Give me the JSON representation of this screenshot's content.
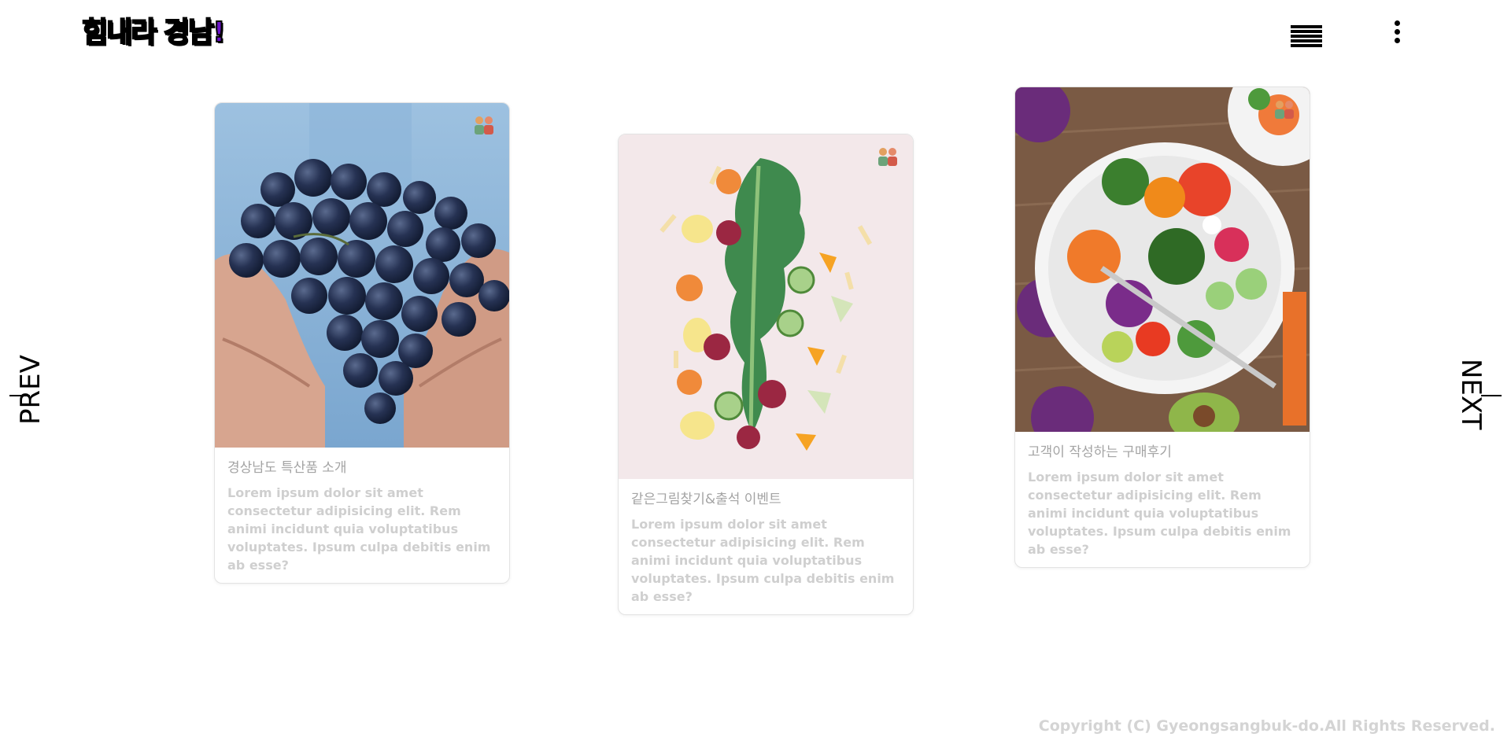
{
  "header": {
    "logo_text": "힘내라 경남!",
    "menu_icon": "hamburger-menu-icon",
    "more_icon": "vertical-dots-icon"
  },
  "navigation": {
    "prev_label": "PREV",
    "next_label": "NEXT"
  },
  "cards": [
    {
      "title": "경상남도 특산품 소개",
      "text": "Lorem ipsum dolor sit amet consectetur adipisicing elit. Rem animi incidunt quia voluptatibus voluptates. Ipsum culpa debitis enim ab esse?",
      "image": "grapes-in-hands-photo",
      "badge_icon": "people-icon"
    },
    {
      "title": "같은그림찾기&출석 이벤트",
      "text": "Lorem ipsum dolor sit amet consectetur adipisicing elit. Rem animi incidunt quia voluptatibus voluptates. Ipsum culpa debitis enim ab esse?",
      "image": "vegetables-flatlay-photo",
      "badge_icon": "people-icon"
    },
    {
      "title": "고객이 작성하는 구매후기",
      "text": "Lorem ipsum dolor sit amet consectetur adipisicing elit. Rem animi incidunt quia voluptatibus voluptates. Ipsum culpa debitis enim ab esse?",
      "image": "salad-bowl-photo",
      "badge_icon": "people-icon"
    }
  ],
  "footer": {
    "copyright": "Copyright (C) Gyeongsangbuk-do.All Rights Reserved."
  },
  "colors": {
    "logo_purple": "#6a12c9",
    "title_gray": "#a4a4a4",
    "text_gray": "#cfcfcf",
    "copyright_gray": "#d4d4d4"
  }
}
